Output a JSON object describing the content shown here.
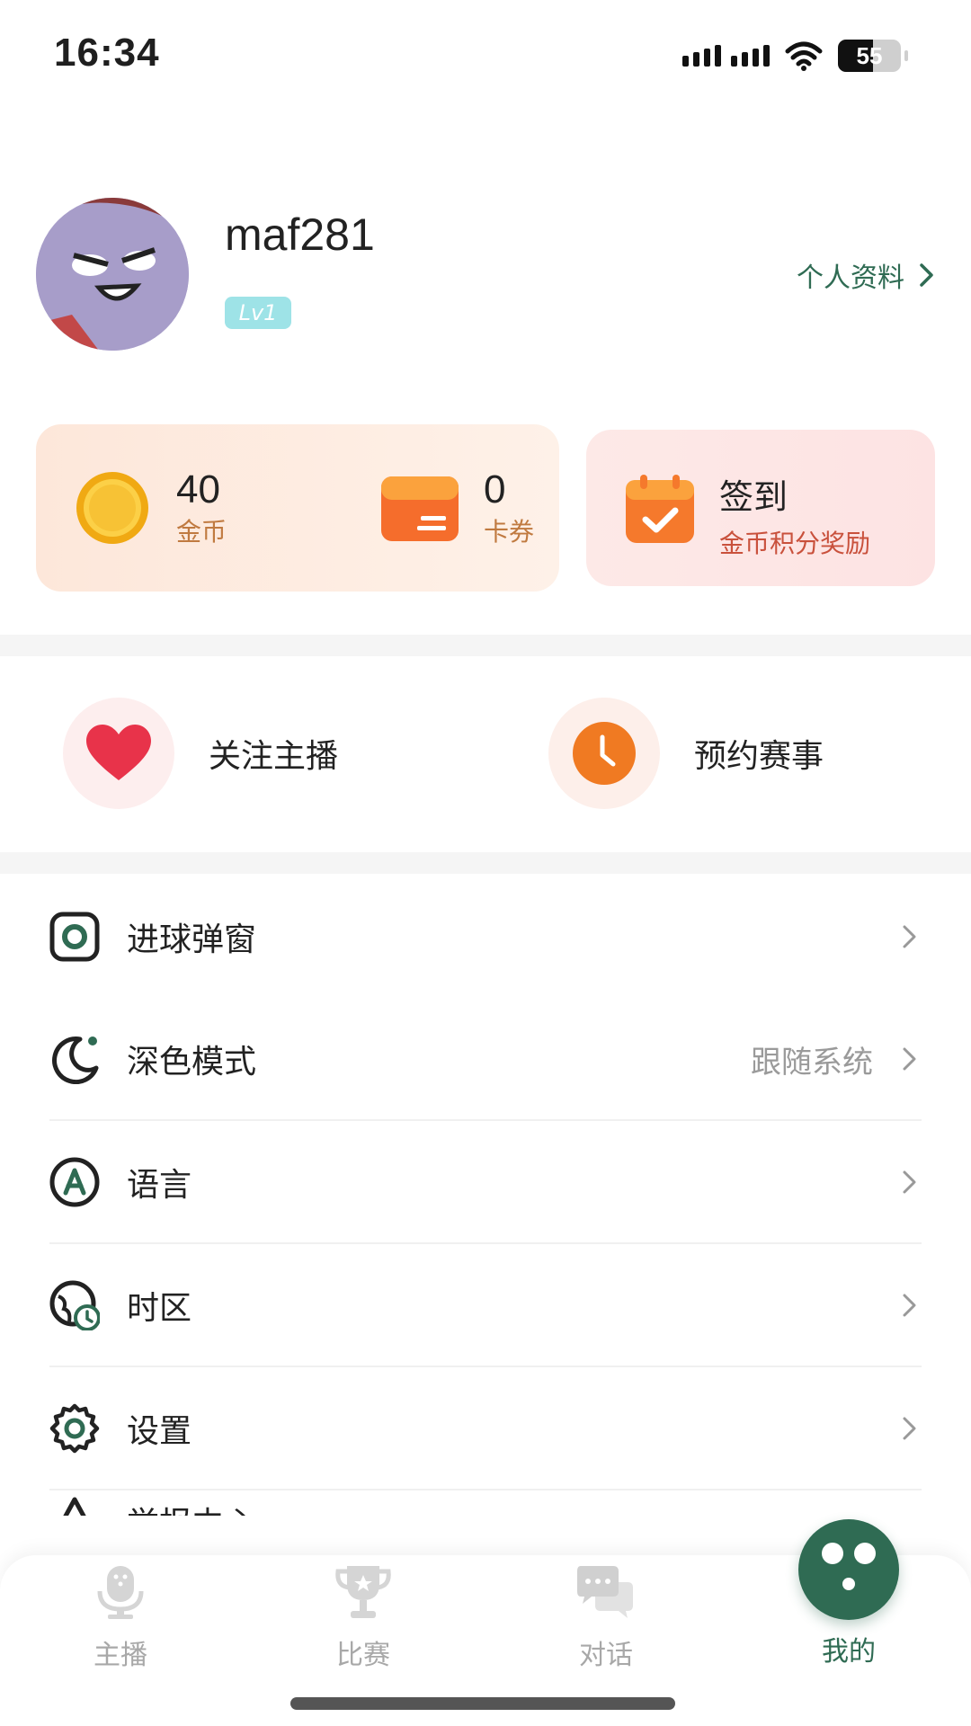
{
  "status_bar": {
    "time": "16:34",
    "battery": "55"
  },
  "profile": {
    "username": "maf281",
    "level": "Lv1",
    "profile_link": "个人资料"
  },
  "wallet": {
    "coins_value": "40",
    "coins_label": "金币",
    "cards_value": "0",
    "cards_label": "卡券",
    "checkin_title": "签到",
    "checkin_subtitle": "金币积分奖励"
  },
  "quick_actions": {
    "follow_label": "关注主播",
    "reserve_label": "预约赛事"
  },
  "menu": {
    "items": [
      {
        "label": "进球弹窗",
        "value": "",
        "icon": "goal-popup-icon"
      },
      {
        "label": "深色模式",
        "value": "跟随系统",
        "icon": "moon-icon"
      },
      {
        "label": "语言",
        "value": "",
        "icon": "language-icon"
      },
      {
        "label": "时区",
        "value": "",
        "icon": "timezone-icon"
      },
      {
        "label": "设置",
        "value": "",
        "icon": "gear-icon"
      }
    ],
    "partial_item": "举报中心"
  },
  "tabs": [
    {
      "label": "主播",
      "icon": "microphone-icon"
    },
    {
      "label": "比赛",
      "icon": "trophy-icon"
    },
    {
      "label": "对话",
      "icon": "chat-icon"
    },
    {
      "label": "我的",
      "icon": "profile-face-icon",
      "active": true
    }
  ],
  "colors": {
    "accent": "#2f6b53",
    "coin": "#f4b428",
    "card": "#f26a2c",
    "heart": "#e8334a",
    "clock": "#f07a22"
  }
}
